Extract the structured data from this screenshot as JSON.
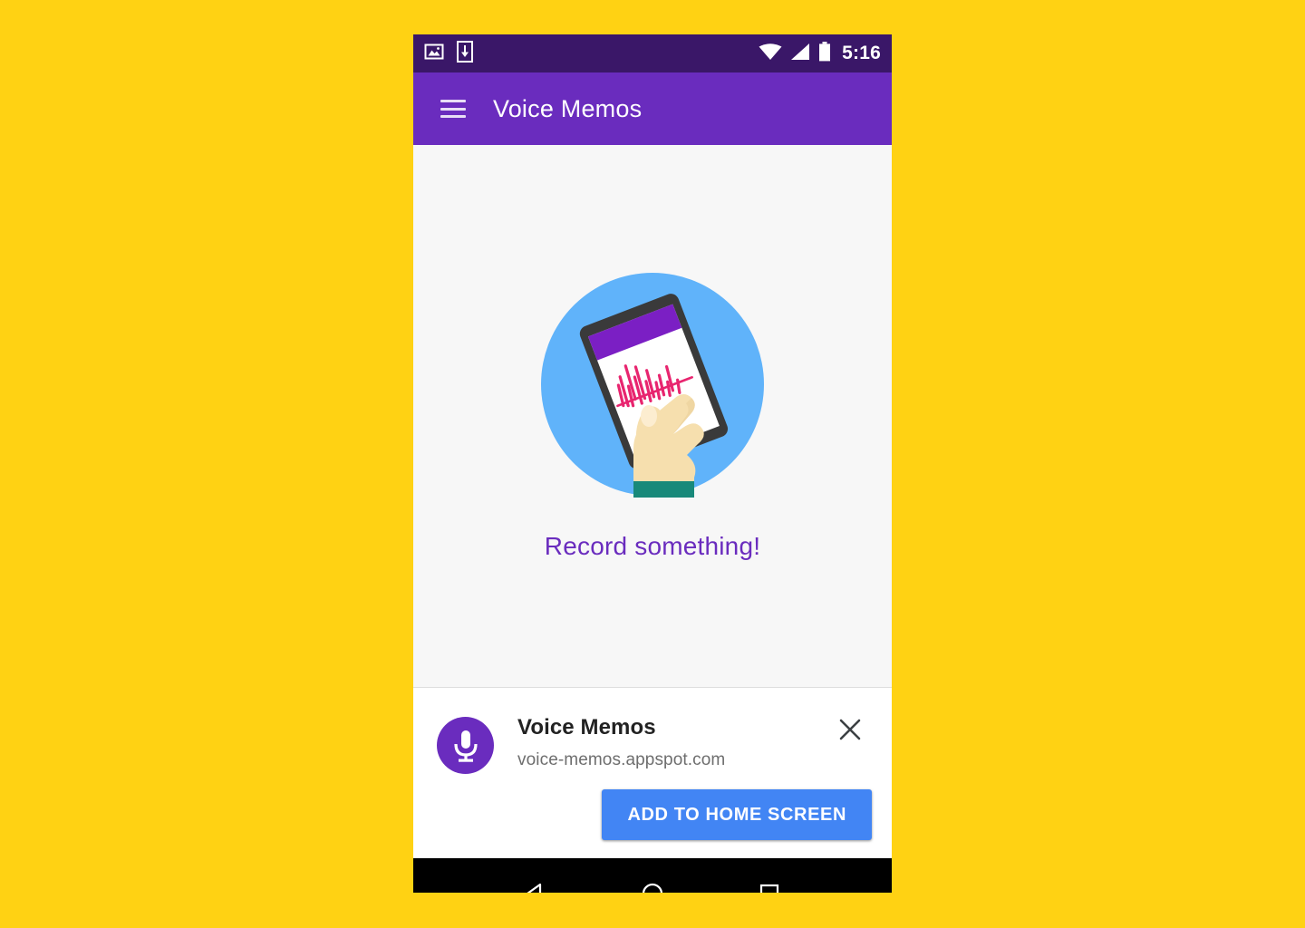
{
  "page": {
    "background_color": "#FFD213"
  },
  "status_bar": {
    "background_color": "#3A1768",
    "time": "5:16",
    "left_icons": [
      {
        "name": "screenshot-image-icon"
      },
      {
        "name": "download-icon"
      }
    ],
    "right_icons": [
      {
        "name": "wifi-icon"
      },
      {
        "name": "cellular-signal-icon"
      },
      {
        "name": "battery-icon"
      }
    ]
  },
  "app_bar": {
    "background_color": "#6A2CBE",
    "menu_icon": "hamburger-menu-icon",
    "title": "Voice Memos"
  },
  "content": {
    "background_color": "#F7F7F7",
    "illustration": {
      "name": "hand-holding-phone-recording-illustration",
      "circle_color": "#60B3FA",
      "phone_frame_color": "#3A3A3A",
      "phone_screen_color": "#FFFFFF",
      "phone_header_color": "#7B1FC4",
      "waveform_color": "#E8256F",
      "skin_color": "#F6DFAE",
      "sleeve_color": "#18897A"
    },
    "empty_state_text": "Record something!",
    "empty_state_color": "#6A2CBE"
  },
  "install_banner": {
    "app_icon": "microphone-icon",
    "app_icon_background": "#6A2CBE",
    "title": "Voice Memos",
    "url": "voice-memos.appspot.com",
    "close_icon": "close-x-icon",
    "install_button_label": "ADD TO HOME SCREEN",
    "install_button_color": "#4285F4"
  },
  "nav_bar": {
    "background_color": "#000000",
    "keys": [
      {
        "name": "back-button",
        "icon": "triangle-left-icon"
      },
      {
        "name": "home-button",
        "icon": "circle-icon"
      },
      {
        "name": "recents-button",
        "icon": "square-icon"
      }
    ]
  }
}
